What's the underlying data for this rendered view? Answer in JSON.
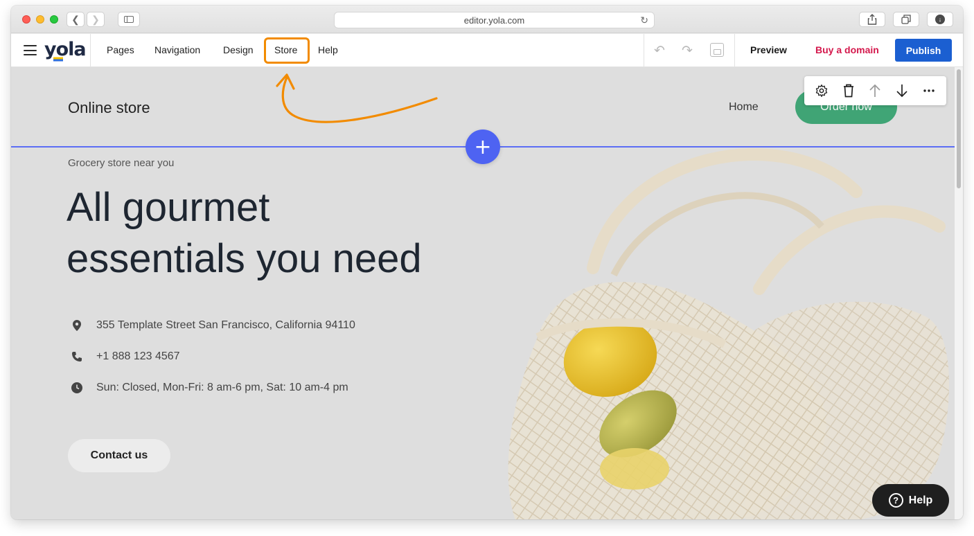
{
  "browser": {
    "url": "editor.yola.com",
    "traffic_lights": [
      "#fe5f57",
      "#febc2e",
      "#28c840"
    ]
  },
  "editor": {
    "logo": "yola",
    "menu": {
      "pages": "Pages",
      "navigation": "Navigation",
      "design": "Design",
      "store": "Store",
      "help": "Help"
    },
    "highlighted_item": "Store",
    "actions": {
      "preview": "Preview",
      "buy_domain": "Buy a domain",
      "publish": "Publish"
    },
    "colors": {
      "publish": "#1b5fd1",
      "buy_domain": "#d4184c",
      "highlight": "#f28b00"
    }
  },
  "site": {
    "title": "Online store",
    "nav_home": "Home",
    "order_button": "Order now",
    "eyebrow": "Grocery store near you",
    "headline_line1": "All gourmet",
    "headline_line2": "essentials you need",
    "address": "355 Template Street San Francisco, California 94110",
    "phone": "+1 888 123 4567",
    "hours": "Sun: Closed, Mon-Fri: 8 am-6 pm, Sat: 10 am-4 pm",
    "contact_button": "Contact us",
    "accent_color": "#2f9e6a"
  },
  "block_toolbar": [
    "gear-icon",
    "trash-icon",
    "arrow-up-icon",
    "arrow-down-icon",
    "more-icon"
  ],
  "insert_button": "+",
  "help_widget": {
    "label": "Help",
    "icon": "?"
  }
}
